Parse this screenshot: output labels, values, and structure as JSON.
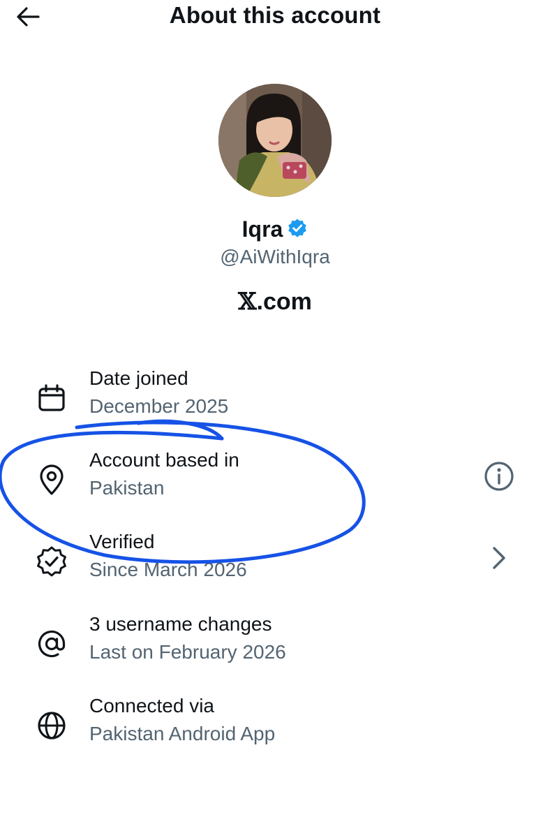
{
  "header": {
    "title": "About this account",
    "back_icon": "arrow-left-icon"
  },
  "profile": {
    "name": "Iqra",
    "handle": "@AiWithIqra",
    "verified_icon": "verified-badge-icon",
    "verified_color": "#1d9bf0",
    "site_mark": "𝕏",
    "site_suffix": ".com"
  },
  "details": [
    {
      "icon": "calendar-icon",
      "title": "Date joined",
      "subtitle": "December 2025"
    },
    {
      "icon": "location-pin-icon",
      "title": "Account based in",
      "subtitle": "Pakistan",
      "action_icon": "info-icon"
    },
    {
      "icon": "verified-outline-icon",
      "title": "Verified",
      "subtitle": "Since March 2026",
      "action_icon": "chevron-right-icon"
    },
    {
      "icon": "at-sign-icon",
      "title": "3 username changes",
      "subtitle": "Last on February 2026"
    },
    {
      "icon": "globe-icon",
      "title": "Connected via",
      "subtitle": "Pakistan Android App"
    }
  ],
  "colors": {
    "text_primary": "#0f1419",
    "text_secondary": "#536471",
    "annotation_stroke": "#1652e6"
  }
}
